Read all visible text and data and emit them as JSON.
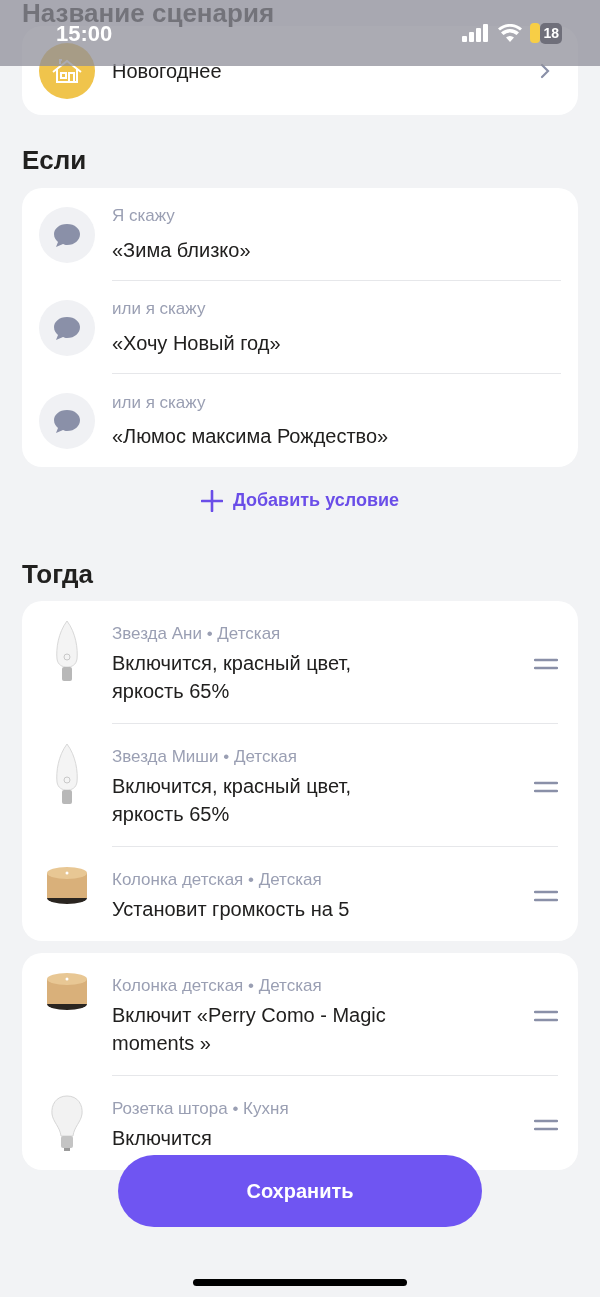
{
  "status_bar": {
    "time": "15:00",
    "battery": "18"
  },
  "title_section": {
    "heading": "Название сценария",
    "name": "Новогоднее"
  },
  "if_section": {
    "heading": "Если",
    "triggers": [
      {
        "label": "Я скажу",
        "phrase": "«Зима близко»"
      },
      {
        "label": "или я скажу",
        "phrase": "«Хочу Новый год»"
      },
      {
        "label": "или я скажу",
        "phrase": "«Люмос максима Рождество»"
      }
    ],
    "add_button": "Добавить условие"
  },
  "then_section": {
    "heading": "Тогда",
    "groups": [
      [
        {
          "kind": "candle",
          "device": "Звезда Ани • Детская",
          "action": "Включится, красный цвет, яркость 65%"
        },
        {
          "kind": "candle",
          "device": "Звезда Миши • Детская",
          "action": "Включится, красный цвет, яркость 65%"
        },
        {
          "kind": "speaker",
          "device": "Колонка детская • Детская",
          "action": "Установит громкость на 5"
        }
      ],
      [
        {
          "kind": "speaker",
          "device": "Колонка детская • Детская",
          "action": "Включит «Perry Como - Magic moments »"
        },
        {
          "kind": "bulb",
          "device": "Розетка штора • Кухня",
          "action": "Включится"
        }
      ]
    ]
  },
  "save_button": "Сохранить"
}
